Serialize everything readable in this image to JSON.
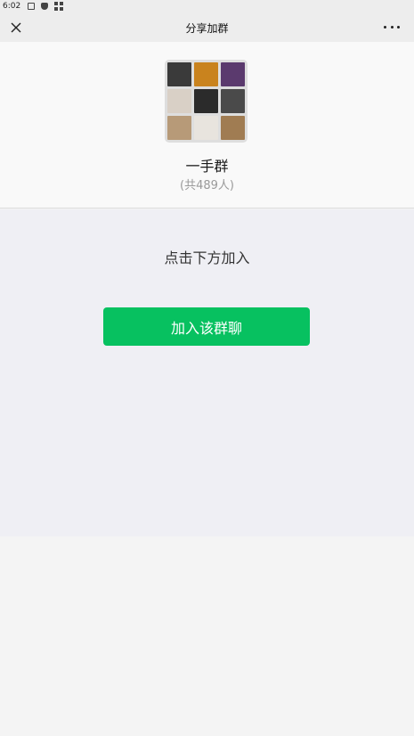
{
  "status_bar": {
    "time": "6:02"
  },
  "title_bar": {
    "title": "分享加群"
  },
  "group": {
    "name": "一手群",
    "member_count": "(共489人)",
    "avatar_tiles": [
      "#3a3a3a",
      "#c9831e",
      "#5b3a6e",
      "#d9d0c6",
      "#2b2b2b",
      "#4a4a4a",
      "#b79a78",
      "#e8e4de",
      "#a07c52"
    ]
  },
  "content": {
    "hint": "点击下方加入",
    "join_button": "加入该群聊"
  },
  "colors": {
    "accent": "#07c160",
    "title_bar_bg": "#ededed",
    "content_bg": "#efeff4"
  }
}
